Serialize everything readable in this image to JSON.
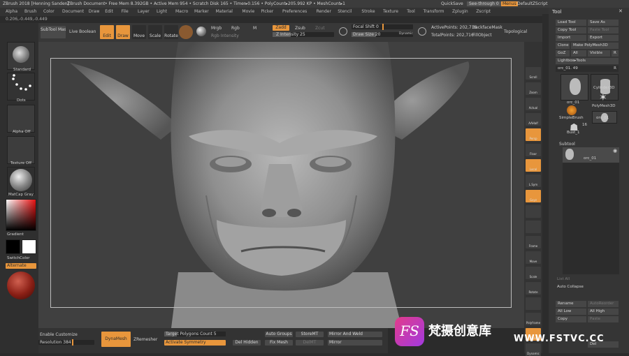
{
  "title_bar": {
    "app": "ZBrush 2018 [Henning Sanden]",
    "doc": "ZBrush Document",
    "stats": "• Free Mem 8.392GB • Active Mem 954 • Scratch Disk 165 • Timer▸0.156 • PolyCount▸205.992 KP • MeshCount▸1",
    "quicksave": "QuickSave",
    "see_through": "See-through  0",
    "menus": "Menus",
    "default_script": "DefaultZScript"
  },
  "menu_bar": [
    "Alpha",
    "Brush",
    "Color",
    "Document",
    "Draw",
    "Edit",
    "File",
    "Layer",
    "Light",
    "Macro",
    "Marker",
    "Material",
    "Movie",
    "Picker",
    "Preferences",
    "Render",
    "Stencil",
    "Stroke",
    "Texture",
    "Tool",
    "Transform",
    "Zplugin",
    "Zscript"
  ],
  "coords": "0.206,-0.449,-0.449",
  "shelf": {
    "subtool_master": "SubTool Master",
    "live_boolean": "Live Boolean",
    "edit": "Edit",
    "draw": "Draw",
    "move": "Move",
    "scale": "Scale",
    "rotate": "Rotate",
    "mrgb": "Mrgb",
    "rgb": "Rgb",
    "m": "M",
    "rgb_intensity": "Rgb Intensity",
    "zadd": "Zadd",
    "zsub": "Zsub",
    "zcut": "Zcut",
    "z_intensity": "Z Intensity 25",
    "focal_shift": "Focal Shift 0",
    "draw_size": "Draw Size 20",
    "dynamic": "Dynamic",
    "active_points": "ActivePoints: 202,716",
    "total_points": "TotalPoints: 202,716",
    "backface_mask": "BackfaceMask",
    "fill_object": "FillObject",
    "topological": "Topological"
  },
  "left_panel": {
    "standard": "Standard",
    "dots": "Dots",
    "alpha_off": "Alpha Off",
    "texture_off": "Texture Off",
    "matcap": "MatCap Gray",
    "gradient": "Gradient",
    "switch_color": "SwitchColor",
    "alternate": "Alternate"
  },
  "right_tools": [
    "Scroll",
    "Zoom",
    "Actual",
    "AAHalf",
    "Persp",
    "Floor",
    "Local",
    "L.Sym",
    "Gxyz",
    "",
    "",
    "Frame",
    "Move",
    "Scale",
    "Rotate",
    "",
    "Polyframe",
    "Solo",
    "Dynamic"
  ],
  "tool_panel": {
    "title": "Tool",
    "load_tool": "Load Tool",
    "save_as": "Save As",
    "copy_tool": "Copy Tool",
    "paste_tool": "Paste Tool",
    "import": "Import",
    "export": "Export",
    "clone": "Clone",
    "make_polymesh": "Make PolyMesh3D",
    "goz": "GoZ",
    "all": "All",
    "visible": "Visible",
    "r": "R",
    "lightbox_tools": "Lightbox▸Tools",
    "current_tool": "orc_01. 49",
    "tools": [
      "orc_01",
      "Cylinder3D",
      "PolyMesh3D",
      "SimpleBrush",
      "orc_01",
      "Bust_1"
    ],
    "count_16": "16",
    "subtool": "Subtool",
    "subtool_item": "orc_01",
    "list_all": "List All",
    "auto_collapse": "Auto Collapse",
    "rename": "Rename",
    "auto_reorder": "AutoReorder",
    "all_low": "All Low",
    "all_high": "All High",
    "copy": "Copy",
    "paste": "Paste",
    "del": "Del"
  },
  "bottom_bar": {
    "enable_customize": "Enable Customize",
    "resolution": "Resolution 384",
    "dynamesh": "DynaMesh",
    "zremesher": "ZRemesher",
    "target_poly": "Target Polygons Count 5",
    "activate_symmetry": "Activate Symmetry",
    "del_hidden": "Del Hidden",
    "auto_groups": "Auto Groups",
    "fix_mesh": "Fix Mesh",
    "store_mt": "StoreMT",
    "del_mt": "DelMT",
    "mirror_weld": "Mirror And Weld",
    "mirror": "Mirror"
  },
  "watermark": {
    "brand": "梵摄创意库",
    "url": "WWW.FSTVC.CC",
    "logo": "FS"
  },
  "colors": {
    "accent": "#e8963c",
    "panel": "#353535",
    "canvas": "#404040"
  }
}
